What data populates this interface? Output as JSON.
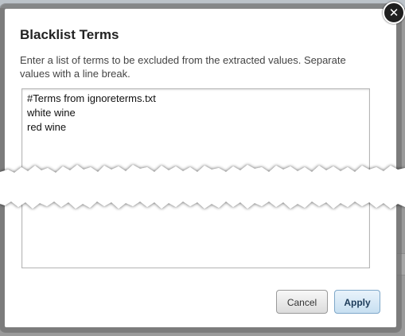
{
  "dialog": {
    "title": "Blacklist Terms",
    "description": "Enter a list of terms to be excluded from the extracted values. Separate values with a line break.",
    "terms": [
      "#Terms from ignoreterms.txt",
      "white wine",
      "red wine"
    ],
    "close_icon": "close-icon",
    "close_label": "✕",
    "buttons": {
      "cancel_label": "Cancel",
      "apply_label": "Apply"
    }
  },
  "colors": {
    "overlay": "#9a9a9a",
    "apply_button": "#c7dff1",
    "dialog_background": "#ffffff"
  }
}
